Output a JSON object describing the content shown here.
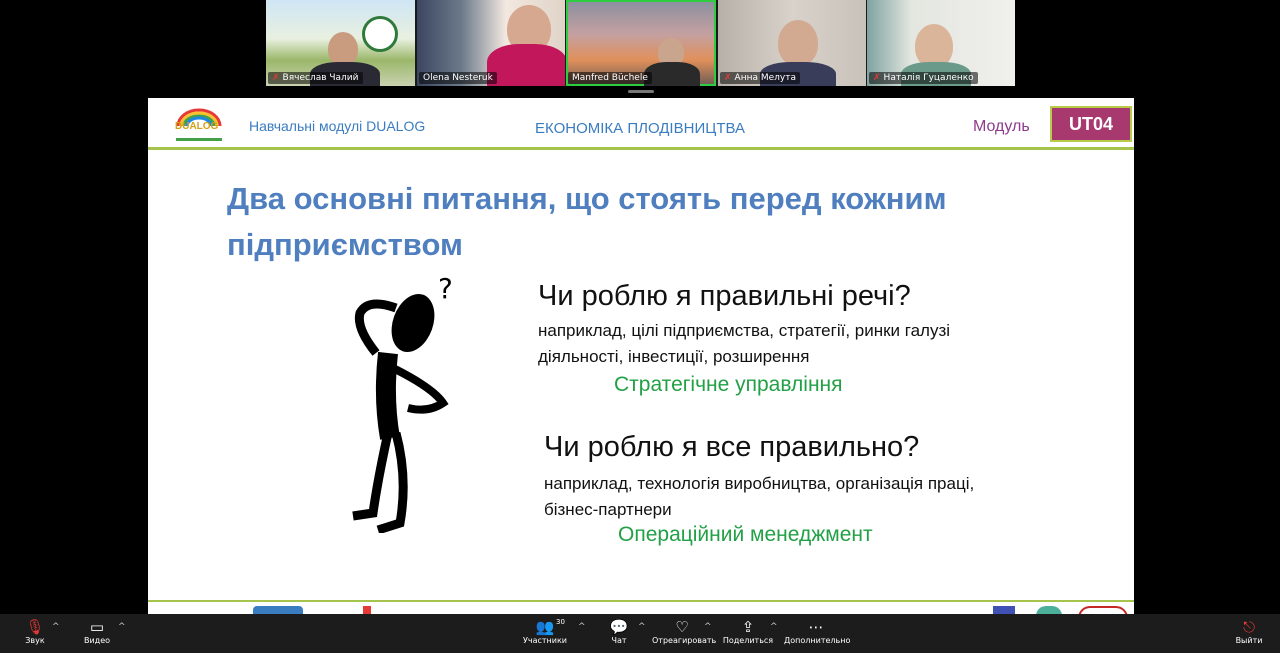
{
  "participants": [
    {
      "name": "Вячеслав Чалий",
      "muted": true
    },
    {
      "name": "Olena Nesteruk",
      "muted": false
    },
    {
      "name": "Manfred Büchele",
      "muted": false,
      "active": true
    },
    {
      "name": "Анна Мелута",
      "muted": true
    },
    {
      "name": "Наталія Гуцаленко",
      "muted": true
    }
  ],
  "slide": {
    "logo_text": "DUALOG",
    "header_left": "Навчальні модулі DUALOG",
    "header_center": "ЕКОНОМІКА ПЛОДІВНИЦТВА",
    "module_label": "Модуль",
    "module_code": "UT04",
    "title": "Два основні питання, що стоять перед кожним підприємством",
    "q1": "Чи роблю я правильні речі?",
    "q1_examples": "наприклад, цілі підприємства, стратегії, ринки галузі діяльності, інвестиції, розширення",
    "q1_answer": "Стратегічне управління",
    "q2": "Чи роблю я все правильно?",
    "q2_examples": "наприклад, технологія виробництва, організація праці, бізнес-партнери",
    "q2_answer": "Операційний менеджмент"
  },
  "toolbar": {
    "audio": "Звук",
    "video": "Видео",
    "participants": "Участники",
    "participants_count": "30",
    "chat": "Чат",
    "react": "Отреагировать",
    "share": "Поделиться",
    "more": "Дополнительно",
    "leave": "Выйти"
  },
  "colors": {
    "title_blue": "#4f7fbf",
    "accent_green": "#22a046",
    "module_box": "#a8396f",
    "rule_green": "#a6c44c"
  }
}
